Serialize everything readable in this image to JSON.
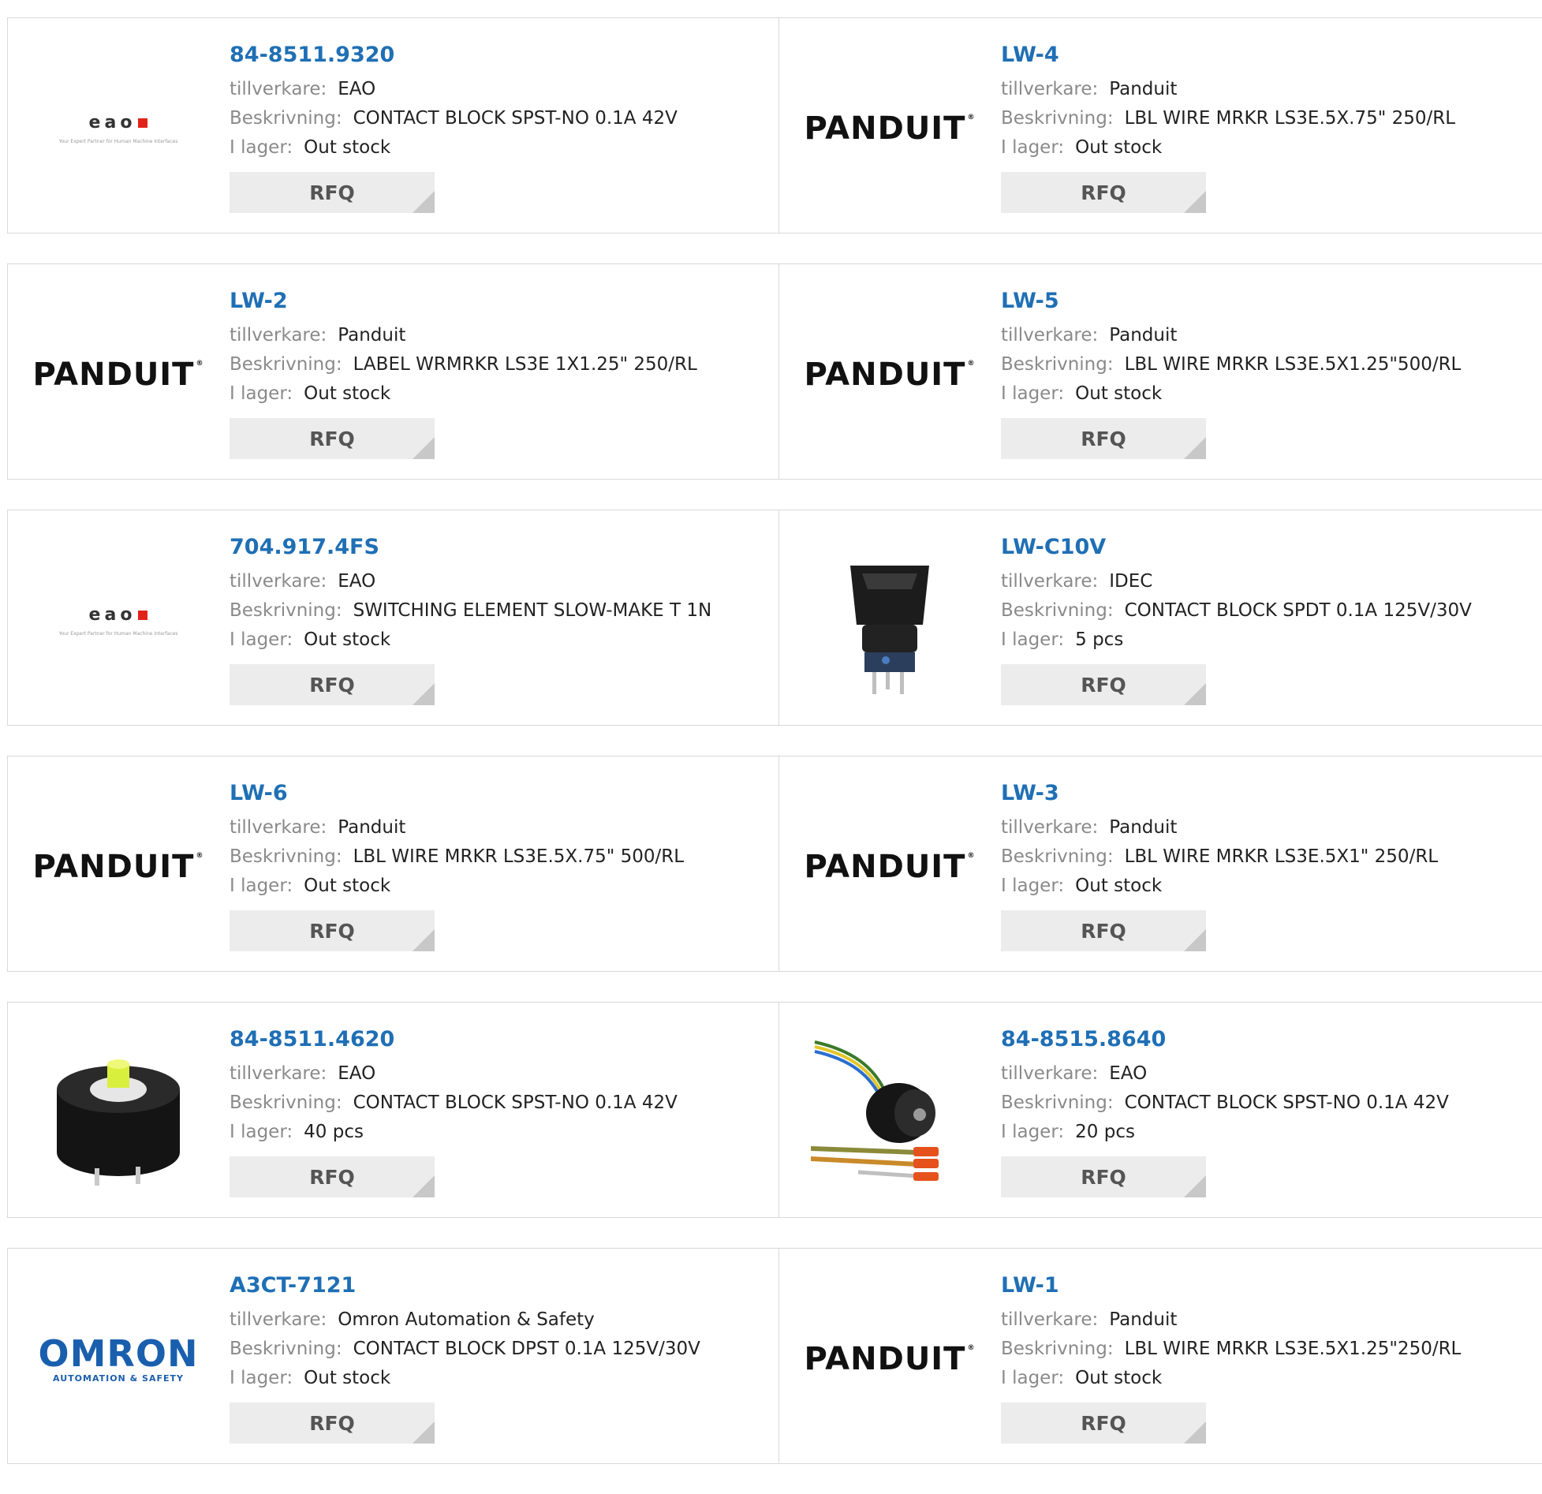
{
  "labels": {
    "manufacturer": "tillverkare:",
    "description": "Beskrivning:",
    "stock": "I lager:",
    "rfq": "RFQ"
  },
  "brands": {
    "eao": {
      "word": "eao",
      "tagline": "Your Expert Partner for Human Machine Interfaces"
    },
    "panduit": {
      "word": "PANDUIT",
      "mark": "®"
    },
    "omron": {
      "word": "OMRON",
      "sub": "AUTOMATION & SAFETY"
    }
  },
  "products": [
    {
      "part": "84-8511.9320",
      "manufacturer": "EAO",
      "description": "CONTACT BLOCK SPST-NO 0.1A 42V",
      "stock": "Out stock",
      "image": "eao-logo"
    },
    {
      "part": "LW-4",
      "manufacturer": "Panduit",
      "description": "LBL WIRE MRKR LS3E.5X.75\" 250/RL",
      "stock": "Out stock",
      "image": "panduit-logo"
    },
    {
      "part": "LW-2",
      "manufacturer": "Panduit",
      "description": "LABEL WRMRKR LS3E 1X1.25\" 250/RL",
      "stock": "Out stock",
      "image": "panduit-logo"
    },
    {
      "part": "LW-5",
      "manufacturer": "Panduit",
      "description": "LBL WIRE MRKR LS3E.5X1.25\"500/RL",
      "stock": "Out stock",
      "image": "panduit-logo"
    },
    {
      "part": "704.917.4FS",
      "manufacturer": "EAO",
      "description": "SWITCHING ELEMENT SLOW-MAKE T 1N",
      "stock": "Out stock",
      "image": "eao-logo"
    },
    {
      "part": "LW-C10V",
      "manufacturer": "IDEC",
      "description": "CONTACT BLOCK SPDT 0.1A 125V/30V",
      "stock": "5 pcs",
      "image": "pushbutton-photo"
    },
    {
      "part": "LW-6",
      "manufacturer": "Panduit",
      "description": "LBL WIRE MRKR LS3E.5X.75\" 500/RL",
      "stock": "Out stock",
      "image": "panduit-logo"
    },
    {
      "part": "LW-3",
      "manufacturer": "Panduit",
      "description": "LBL WIRE MRKR LS3E.5X1\" 250/RL",
      "stock": "Out stock",
      "image": "panduit-logo"
    },
    {
      "part": "84-8511.4620",
      "manufacturer": "EAO",
      "description": "CONTACT BLOCK SPST-NO 0.1A 42V",
      "stock": "40 pcs",
      "image": "contact-block-photo"
    },
    {
      "part": "84-8515.8640",
      "manufacturer": "EAO",
      "description": "CONTACT BLOCK SPST-NO 0.1A 42V",
      "stock": "20 pcs",
      "image": "wired-contact-block-photo"
    },
    {
      "part": "A3CT-7121",
      "manufacturer": "Omron Automation & Safety",
      "description": "CONTACT BLOCK DPST 0.1A 125V/30V",
      "stock": "Out stock",
      "image": "omron-logo"
    },
    {
      "part": "LW-1",
      "manufacturer": "Panduit",
      "description": "LBL WIRE MRKR LS3E.5X1.25\"250/RL",
      "stock": "Out stock",
      "image": "panduit-logo"
    }
  ],
  "colors": {
    "link": "#1f6fb5",
    "label": "#8a8a8a",
    "border": "#d9d9d9",
    "rfq_bg": "#ececec",
    "eao_red": "#e2231a",
    "omron_blue": "#1a5fad"
  }
}
